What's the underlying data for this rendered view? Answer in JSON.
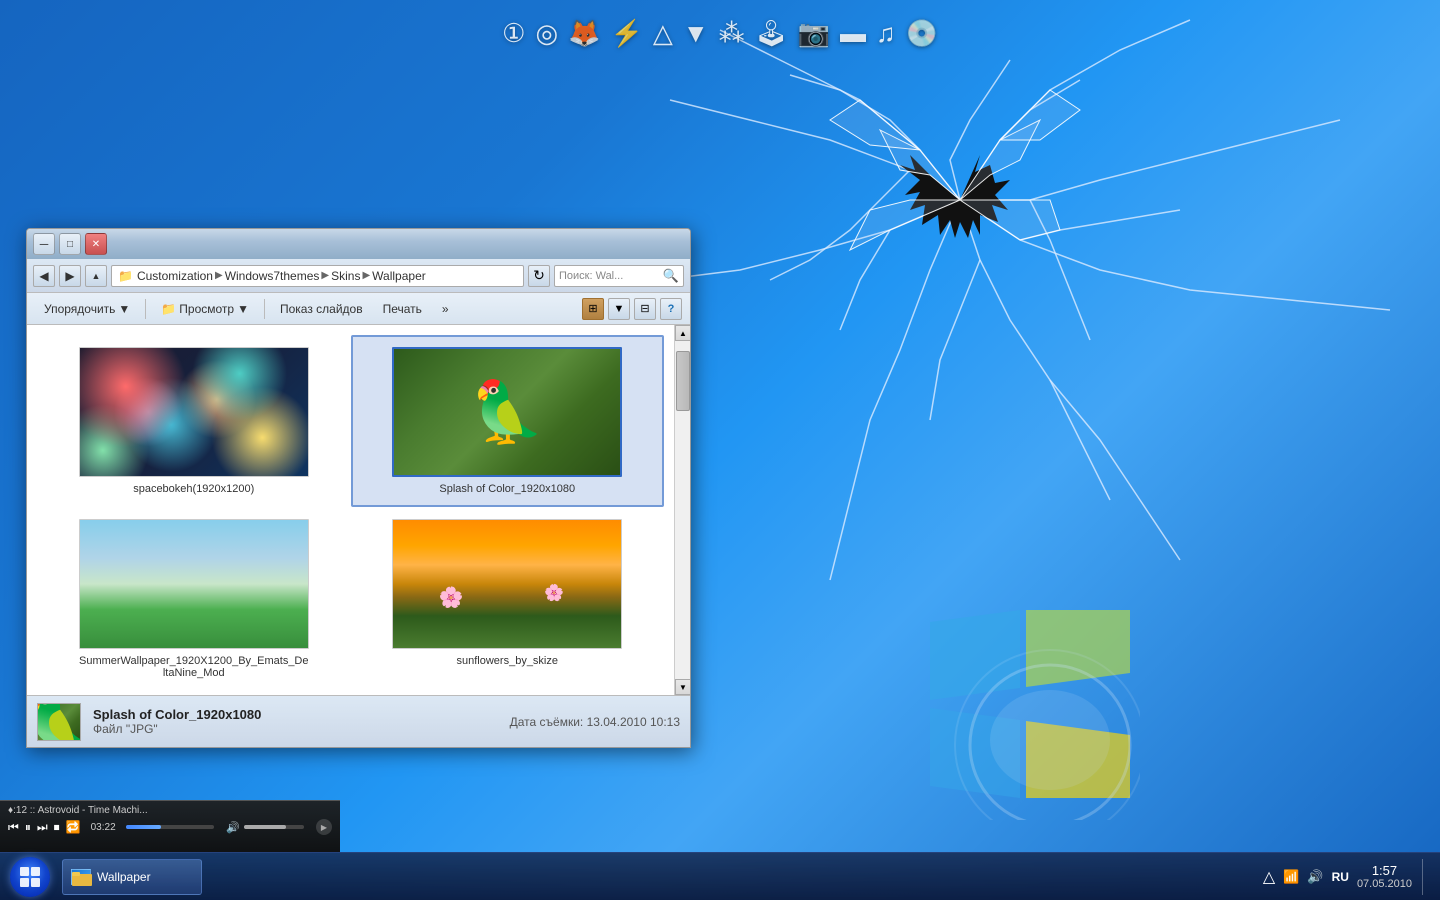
{
  "desktop": {
    "background_color": "#1565c0"
  },
  "top_icons": {
    "icons": [
      "①",
      "◎",
      "🔥",
      "⚡",
      "△",
      "▲",
      "♦",
      "🎮",
      "📷",
      "▬",
      "♫",
      "💿"
    ]
  },
  "explorer": {
    "title": "Wallpaper",
    "breadcrumb": {
      "parts": [
        "Customization",
        "Windows7themes",
        "Skins",
        "Wallpaper"
      ]
    },
    "search_placeholder": "Поиск: Wal...",
    "toolbar": {
      "arrange": "Упорядочить",
      "view": "Просмотр",
      "slideshow": "Показ слайдов",
      "print": "Печать",
      "more": "»"
    },
    "files": [
      {
        "name": "spacebokeh(1920x1200)",
        "type": "bokeh",
        "selected": false
      },
      {
        "name": "Splash of Color_1920x1080",
        "type": "parrot",
        "selected": true
      },
      {
        "name": "SummerWallpaper_1920X1200_By_Emats_DeltaNine_Mod",
        "type": "summer",
        "selected": false
      },
      {
        "name": "sunflowers_by_skize",
        "type": "sunflowers",
        "selected": false
      }
    ],
    "status": {
      "filename": "Splash of Color_1920x1080",
      "filetype": "Файл \"JPG\"",
      "date_label": "Дата съёмки:",
      "date_value": "13.04.2010 10:13"
    }
  },
  "taskbar": {
    "wallpaper_label": "Wallpaper",
    "media": {
      "title": "♦:12 :: Astrovoid - Time Machi...",
      "time": "03:22"
    },
    "tray": {
      "language": "RU",
      "time": "1:57",
      "date": "07.05.2010"
    }
  }
}
